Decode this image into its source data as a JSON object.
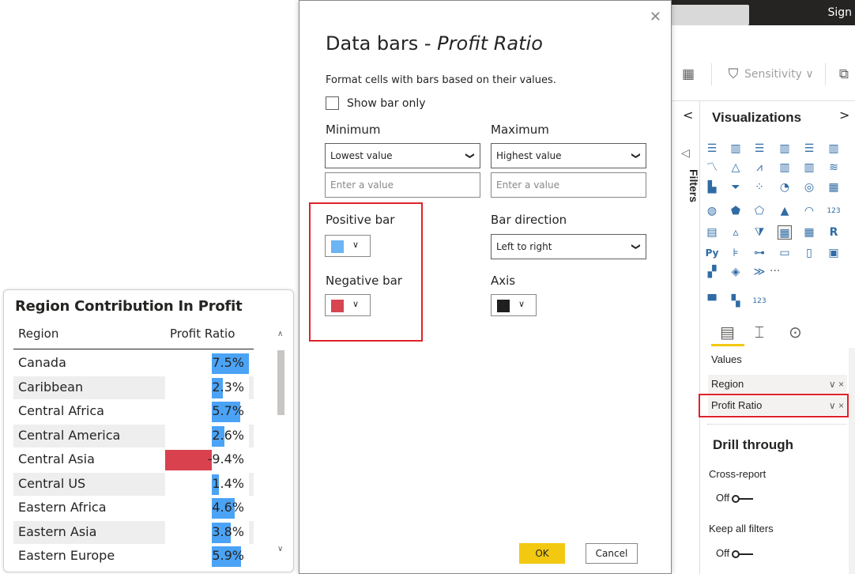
{
  "app": {
    "sign_label": "Sign",
    "sensitivity_label": "Sensitivity"
  },
  "filters": {
    "label": "Filters"
  },
  "visualizations": {
    "title": "Visualizations",
    "more_label": "···",
    "values_label": "Values",
    "wells": [
      "Region",
      "Profit Ratio"
    ],
    "well_controls": "∨ ×",
    "drill_title": "Drill through",
    "cross_report_label": "Cross-report",
    "cross_report_state": "Off",
    "keep_filters_label": "Keep all filters",
    "keep_filters_state": "Off"
  },
  "table": {
    "title": "Region Contribution In Profit",
    "columns": [
      "Region",
      "Profit Ratio"
    ],
    "rows": [
      {
        "region": "Canada",
        "value": "7.5%",
        "ratio": 7.5
      },
      {
        "region": "Caribbean",
        "value": "2.3%",
        "ratio": 2.3
      },
      {
        "region": "Central Africa",
        "value": "5.7%",
        "ratio": 5.7
      },
      {
        "region": "Central America",
        "value": "2.6%",
        "ratio": 2.6
      },
      {
        "region": "Central Asia",
        "value": "-9.4%",
        "ratio": -9.4
      },
      {
        "region": "Central US",
        "value": "1.4%",
        "ratio": 1.4
      },
      {
        "region": "Eastern Africa",
        "value": "4.6%",
        "ratio": 4.6
      },
      {
        "region": "Eastern Asia",
        "value": "3.8%",
        "ratio": 3.8
      },
      {
        "region": "Eastern Europe",
        "value": "5.9%",
        "ratio": 5.9
      }
    ],
    "positive_color": "#4ba3f5",
    "negative_color": "#d9414e"
  },
  "dialog": {
    "title_prefix": "Data bars - ",
    "title_field": "Profit Ratio",
    "close_glyph": "✕",
    "description": "Format cells with bars based on their values.",
    "show_bar_only_label": "Show bar only",
    "minimum_label": "Minimum",
    "maximum_label": "Maximum",
    "minimum_select": "Lowest value",
    "maximum_select": "Highest value",
    "min_input_placeholder": "Enter a value",
    "max_input_placeholder": "Enter a value",
    "positive_bar_label": "Positive bar",
    "bar_direction_label": "Bar direction",
    "bar_direction_select": "Left to right",
    "negative_bar_label": "Negative bar",
    "axis_label": "Axis",
    "positive_bar_color": "#6cb4f3",
    "negative_bar_color": "#d64550",
    "axis_color": "#1f1f1f",
    "ok_label": "OK",
    "cancel_label": "Cancel"
  }
}
